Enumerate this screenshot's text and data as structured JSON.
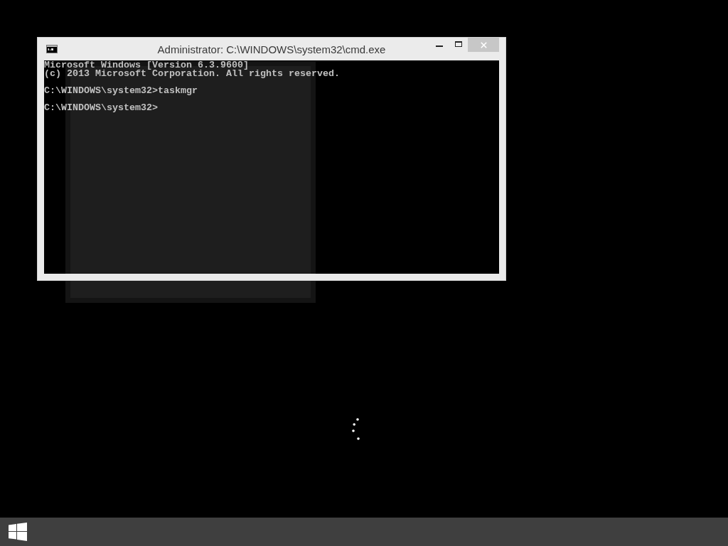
{
  "window": {
    "title": "Administrator: C:\\WINDOWS\\system32\\cmd.exe",
    "active": false
  },
  "console": {
    "blocks": [
      [
        "Microsoft Windows [Version 6.3.9600]",
        "(c) 2013 Microsoft Corporation. All rights reserved."
      ],
      [
        "C:\\WINDOWS\\system32>taskmgr"
      ],
      [
        "C:\\WINDOWS\\system32>"
      ]
    ]
  },
  "desktop": {
    "busy": true
  }
}
